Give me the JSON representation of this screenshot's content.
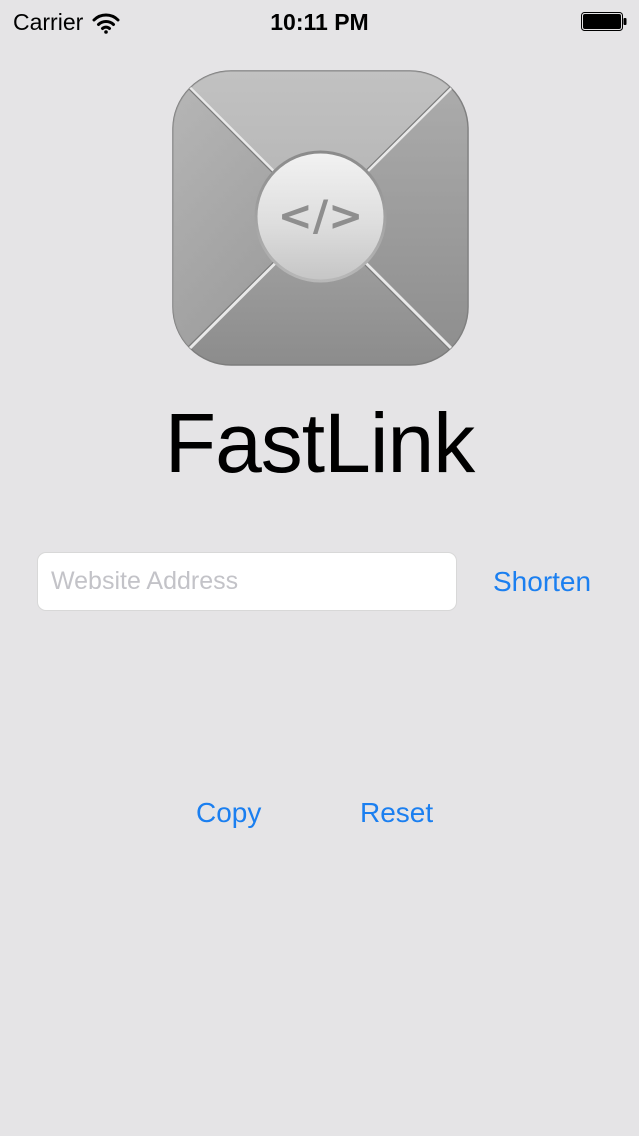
{
  "status_bar": {
    "carrier": "Carrier",
    "time": "10:11 PM",
    "wifi_icon": "wifi-icon",
    "battery_icon": "battery-icon"
  },
  "app": {
    "icon": "fastlink-logo-icon",
    "icon_glyph": "</>",
    "title": "FastLink"
  },
  "form": {
    "url_placeholder": "Website Address",
    "url_value": "",
    "shorten_label": "Shorten"
  },
  "actions": {
    "copy_label": "Copy",
    "reset_label": "Reset"
  },
  "colors": {
    "background": "#e5e4e6",
    "accent": "#1b7ff0",
    "title_text": "#000000"
  }
}
